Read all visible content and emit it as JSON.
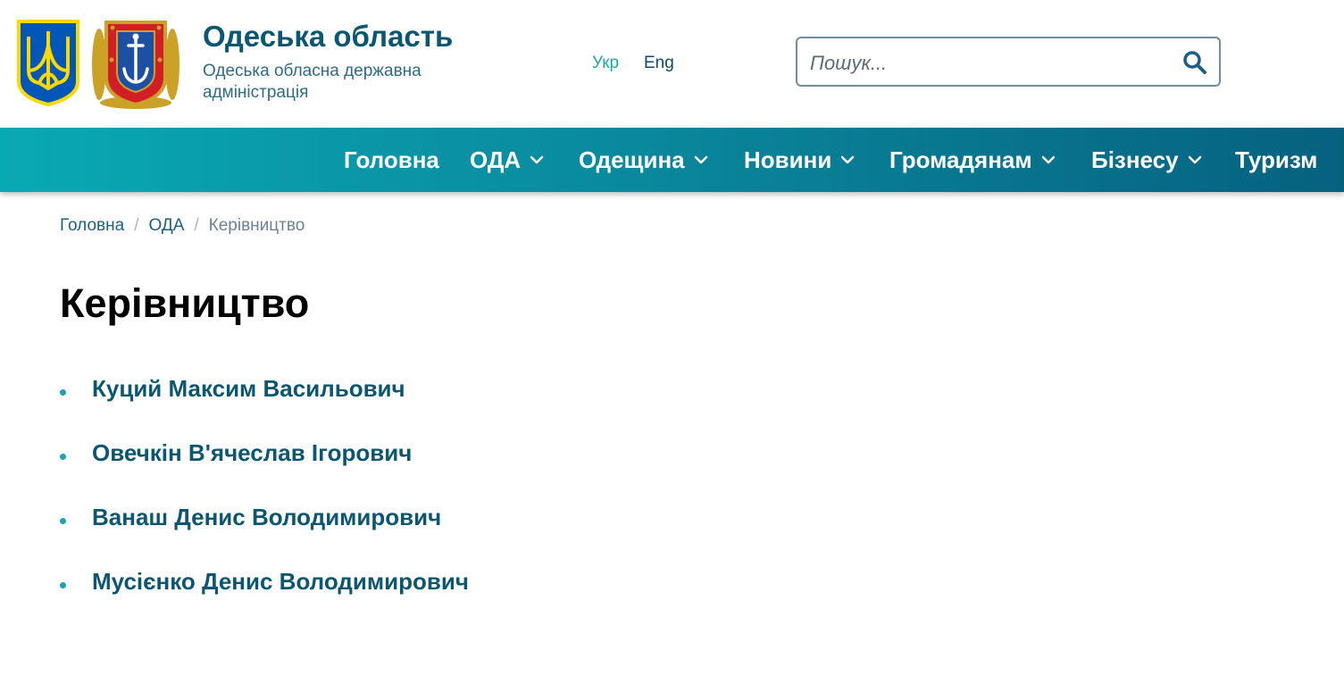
{
  "header": {
    "title": "Одеська область",
    "subtitle": "Одеська обласна державна адміністрація",
    "languages": [
      {
        "label": "Укр",
        "active": true
      },
      {
        "label": "Eng",
        "active": false
      }
    ],
    "search": {
      "placeholder": "Пошук...",
      "value": ""
    },
    "emblem_colors": {
      "ua_blue": "#0057b8",
      "ua_yellow": "#ffd700",
      "odesa_red": "#d21f26",
      "odesa_gold": "#c9a227"
    }
  },
  "nav": {
    "items": [
      {
        "label": "Головна",
        "has_dropdown": false
      },
      {
        "label": "ОДА",
        "has_dropdown": true
      },
      {
        "label": "Одещина",
        "has_dropdown": true
      },
      {
        "label": "Новини",
        "has_dropdown": true
      },
      {
        "label": "Громадянам",
        "has_dropdown": true
      },
      {
        "label": "Бізнесу",
        "has_dropdown": true
      },
      {
        "label": "Туризм",
        "has_dropdown": false
      }
    ],
    "gradient": [
      "#09a9b4",
      "#06617f"
    ]
  },
  "breadcrumb": {
    "items": [
      "Головна",
      "ОДА"
    ],
    "current": "Керівництво"
  },
  "page": {
    "title": "Керівництво",
    "leaders": [
      "Куций Максим Васильович",
      "Овечкін В'ячеслав Ігорович",
      "Ванаш Денис Володимирович",
      "Мусієнко Денис Володимирович"
    ]
  },
  "icons": {
    "search": "search-icon",
    "dropdown": "chevron-down-icon"
  }
}
